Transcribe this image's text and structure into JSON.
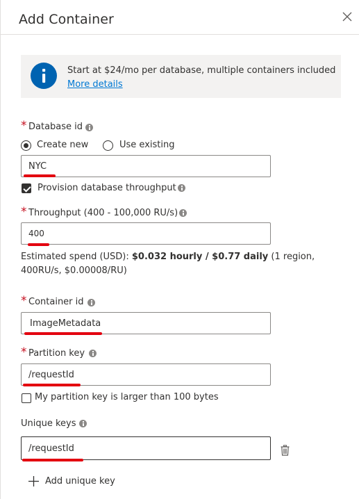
{
  "header": {
    "title": "Add Container"
  },
  "info": {
    "message": "Start at $24/mo per database, multiple containers included",
    "link": "More details"
  },
  "database": {
    "label": "Database id",
    "radio_create": "Create new",
    "radio_existing": "Use existing",
    "selected": "Create new",
    "value": "NYC",
    "provision_label": "Provision database throughput",
    "provision_checked": true
  },
  "throughput": {
    "label": "Throughput (400 - 100,000 RU/s)",
    "value": "400",
    "spend_prefix": "Estimated spend (USD): ",
    "spend_bold": "$0.032 hourly / $0.77 daily",
    "spend_suffix": " (1 region, 400RU/s, $0.00008/RU)"
  },
  "container": {
    "label": "Container id",
    "value": "ImageMetadata"
  },
  "partition": {
    "label": "Partition key",
    "value": "/requestId",
    "large_key_label": "My partition key is larger than 100 bytes",
    "large_key_checked": false
  },
  "unique_keys": {
    "label": "Unique keys",
    "value": "/requestId",
    "add_label": "Add unique key"
  },
  "colors": {
    "required": "#c50f1f",
    "link": "#0078d4",
    "info_icon": "#0063b1",
    "annotation": "#e3000f"
  }
}
